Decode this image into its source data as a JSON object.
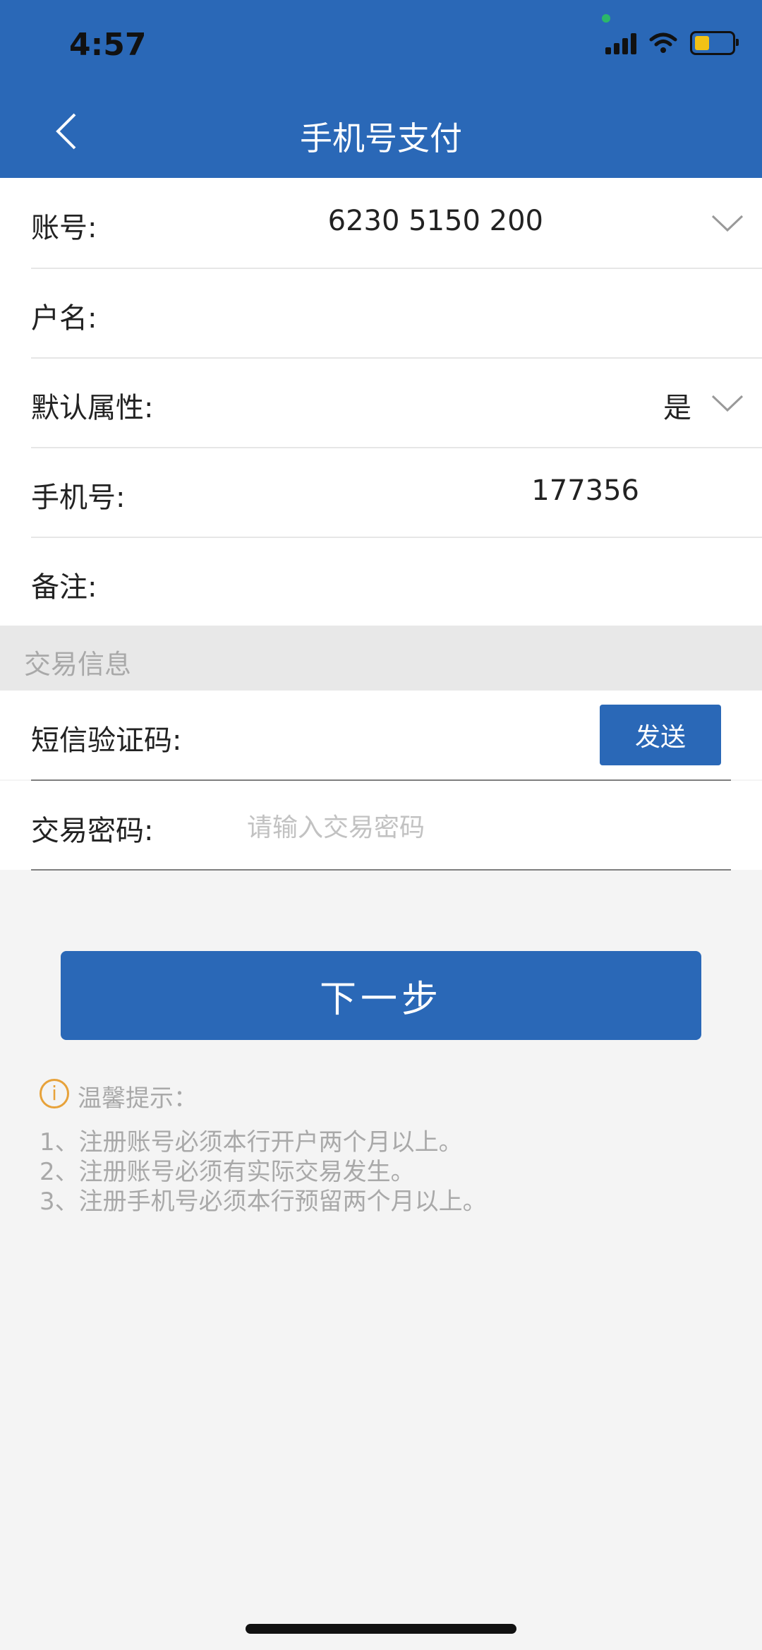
{
  "status_bar": {
    "time": "4:57"
  },
  "header": {
    "title": "手机号支付"
  },
  "account_info": {
    "account": {
      "label": "账号:",
      "value": "6230 5150 200"
    },
    "name": {
      "label": "户名:",
      "value": ""
    },
    "default_property": {
      "label": "默认属性:",
      "value": "是"
    },
    "phone": {
      "label": "手机号:",
      "value": "177356"
    },
    "remark": {
      "label": "备注:",
      "value": ""
    }
  },
  "transaction_section": {
    "title": "交易信息"
  },
  "sms_code": {
    "label": "短信验证码:",
    "send_label": "发送"
  },
  "transaction_password": {
    "label": "交易密码:",
    "placeholder": "请输入交易密码"
  },
  "next_button": {
    "label": "下一步"
  },
  "tips": {
    "title": "温馨提示：",
    "items": [
      "1、注册账号必须本行开户两个月以上。",
      "2、注册账号必须有实际交易发生。",
      "3、注册手机号必须本行预留两个月以上。"
    ]
  },
  "colors": {
    "primary": "#2a68b7",
    "tip_orange": "#e7a23a"
  }
}
